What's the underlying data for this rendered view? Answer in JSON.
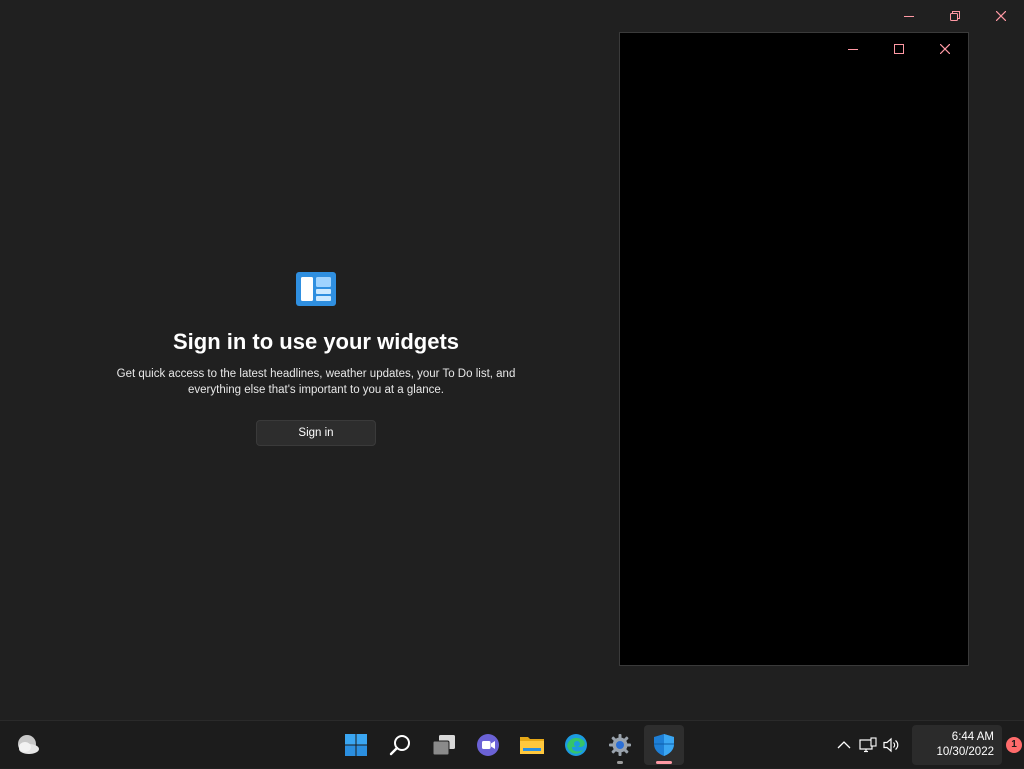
{
  "widgets": {
    "title": "Sign in to use your widgets",
    "description": "Get quick access to the latest headlines, weather updates, your To Do list, and everything else that's important to you at a glance.",
    "sign_in_label": "Sign in",
    "logo_icon": "widgets-icon"
  },
  "colors": {
    "accent_pink": "#ff99a4",
    "widget_blue": "#2f8fe0",
    "background": "#202020",
    "taskbar": "#1c1c1c"
  },
  "taskbar": {
    "apps": [
      {
        "name": "start-button",
        "icon": "windows-logo-icon"
      },
      {
        "name": "search-button",
        "icon": "search-icon"
      },
      {
        "name": "task-view-button",
        "icon": "task-view-icon"
      },
      {
        "name": "teams-chat-button",
        "icon": "teams-icon"
      },
      {
        "name": "file-explorer-button",
        "icon": "folder-icon"
      },
      {
        "name": "edge-button",
        "icon": "edge-icon"
      },
      {
        "name": "settings-button",
        "icon": "gear-icon"
      },
      {
        "name": "security-button",
        "icon": "shield-icon"
      }
    ],
    "clock": {
      "time": "6:44 AM",
      "date": "10/30/2022"
    },
    "notification_count": "1"
  }
}
